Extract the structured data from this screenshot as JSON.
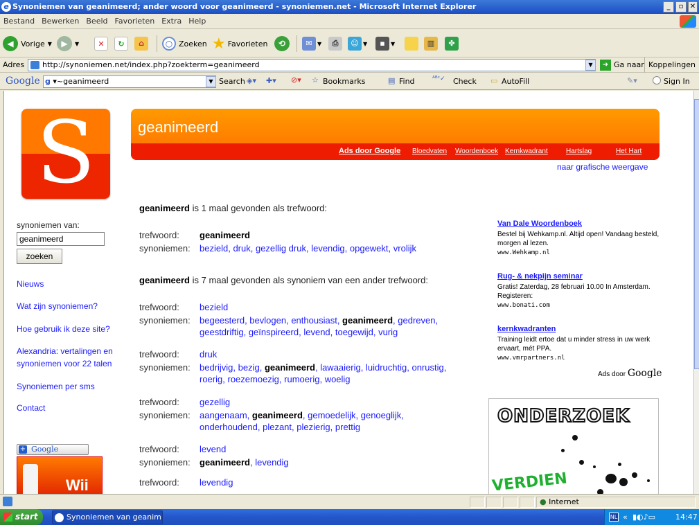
{
  "window": {
    "title": "Synoniemen van geanimeerd; ander woord voor geanimeerd - synoniemen.net - Microsoft Internet Explorer"
  },
  "menu": [
    "Bestand",
    "Bewerken",
    "Beeld",
    "Favorieten",
    "Extra",
    "Help"
  ],
  "toolbar": {
    "back": "Vorige",
    "search": "Zoeken",
    "favorites": "Favorieten"
  },
  "address": {
    "label": "Adres",
    "url": "http://synoniemen.net/index.php?zoekterm=geanimeerd",
    "go": "Ga naar",
    "links": "Koppelingen"
  },
  "google_toolbar": {
    "logo": "Google",
    "query": "~geanimeerd",
    "search": "Search",
    "bookmarks": "Bookmarks",
    "find": "Find",
    "check": "Check",
    "autofill": "AutoFill",
    "signin": "Sign In"
  },
  "banner": {
    "logo_letter": "S",
    "title": "geanimeerd",
    "ads_label": "Ads door Google",
    "links": [
      "Bloedvaten",
      "Woordenboek",
      "Kernkwadrant",
      "Hartslag",
      "Het Hart"
    ],
    "graphic_view": "naar grafische weergave"
  },
  "sidebar": {
    "search_label": "synoniemen van:",
    "search_value": "geanimeerd",
    "search_button": "zoeken",
    "nav": [
      "Nieuws",
      "Wat zijn synoniemen?",
      "Hoe gebruik ik deze site?",
      "Alexandria: vertalingen en synoniemen voor 22 talen",
      "Synoniemen per sms",
      "Contact"
    ],
    "widget_label": "Google",
    "widget_text": "Wii"
  },
  "main": {
    "found_as_keyword_term": "geanimeerd",
    "found_as_keyword_text": "is 1 maal gevonden als trefwoord:",
    "found_as_synonym_term": "geanimeerd",
    "found_as_synonym_text": "is 7 maal gevonden als synoniem van een ander trefwoord:",
    "label_keyword": "trefwoord:",
    "label_synonyms": "synoniemen:",
    "primary": {
      "keyword": "geanimeerd",
      "synonyms": [
        "bezield",
        "druk",
        "gezellig druk",
        "levendig",
        "opgewekt",
        "vrolijk"
      ]
    },
    "entries": [
      {
        "keyword": "bezield",
        "synonyms": [
          "begeesterd",
          "bevlogen",
          "enthousiast",
          "geanimeerd",
          "gedreven",
          "geestdriftig",
          "geïnspireerd",
          "levend",
          "toegewijd",
          "vurig"
        ]
      },
      {
        "keyword": "druk",
        "synonyms": [
          "bedrijvig",
          "bezig",
          "geanimeerd",
          "lawaaierig",
          "luidruchtig",
          "onrustig",
          "roerig",
          "roezemoezig",
          "rumoerig",
          "woelig"
        ]
      },
      {
        "keyword": "gezellig",
        "synonyms": [
          "aangenaam",
          "geanimeerd",
          "gemoedelijk",
          "genoeglijk",
          "onderhoudend",
          "plezant",
          "plezierig",
          "prettig"
        ]
      },
      {
        "keyword": "levend",
        "synonyms": [
          "geanimeerd",
          "levendig"
        ]
      },
      {
        "keyword": "levendig",
        "synonyms": []
      }
    ]
  },
  "ads": [
    {
      "title": "Van Dale Woordenboek",
      "text": "Bestel bij Wehkamp.nl. Altijd open! Vandaag besteld, morgen al lezen.",
      "url": "www.Wehkamp.nl"
    },
    {
      "title": "Rug- & nekpijn seminar",
      "text": "Gratis! Zaterdag, 28 februari 10.00 In Amsterdam. Registeren:",
      "url": "www.bonati.com"
    },
    {
      "title": "kernkwadranten",
      "text": "Training leidt ertoe dat u minder stress in uw werk ervaart, mét PPA.",
      "url": "www.vmrpartners.nl"
    }
  ],
  "ads_footer": {
    "prefix": "Ads door",
    "brand": "Google"
  },
  "banner_ad": {
    "line1": "ONDERZOEK",
    "line2": "VERDIEN"
  },
  "status": {
    "zone": "Internet"
  },
  "taskbar": {
    "start": "start",
    "item": "Synoniemen van geanim...",
    "lang": "NL",
    "time": "14:47"
  },
  "colors": {
    "accent_orange": "#ff8800",
    "accent_red": "#ee1c00",
    "link": "#1a1aff"
  }
}
